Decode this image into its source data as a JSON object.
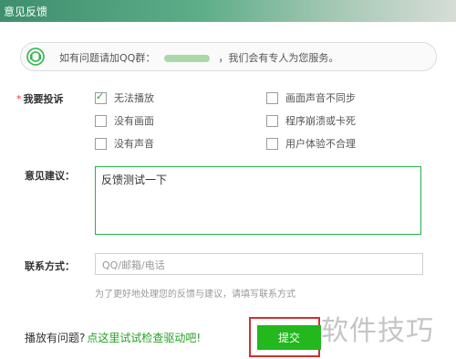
{
  "window": {
    "title": "意见反馈"
  },
  "info_banner": {
    "text_before": "如有问题请加QQ群：",
    "text_after": "，我们会有专人为您服务。"
  },
  "complaint": {
    "label": "我要投诉",
    "required_mark": "*",
    "options": [
      {
        "label": "无法播放",
        "checked": true
      },
      {
        "label": "画面声音不同步",
        "checked": false
      },
      {
        "label": "没有画面",
        "checked": false
      },
      {
        "label": "程序崩溃或卡死",
        "checked": false
      },
      {
        "label": "没有声音",
        "checked": false
      },
      {
        "label": "用户体验不合理",
        "checked": false
      }
    ]
  },
  "suggestion": {
    "label": "意见建议：",
    "value": "反馈测试一下"
  },
  "contact": {
    "label": "联系方式：",
    "placeholder": "QQ/邮箱/电话",
    "hint": "为了更好地处理您的反馈与建议，请填写联系方式"
  },
  "footer": {
    "question": "播放有问题?",
    "link": "点这里试试检查驱动吧!",
    "submit_label": "提交"
  },
  "watermark": "软件技巧",
  "colors": {
    "accent_green": "#22b81e",
    "highlight_red": "#d32f2f",
    "title_green": "#3e8f6e"
  }
}
